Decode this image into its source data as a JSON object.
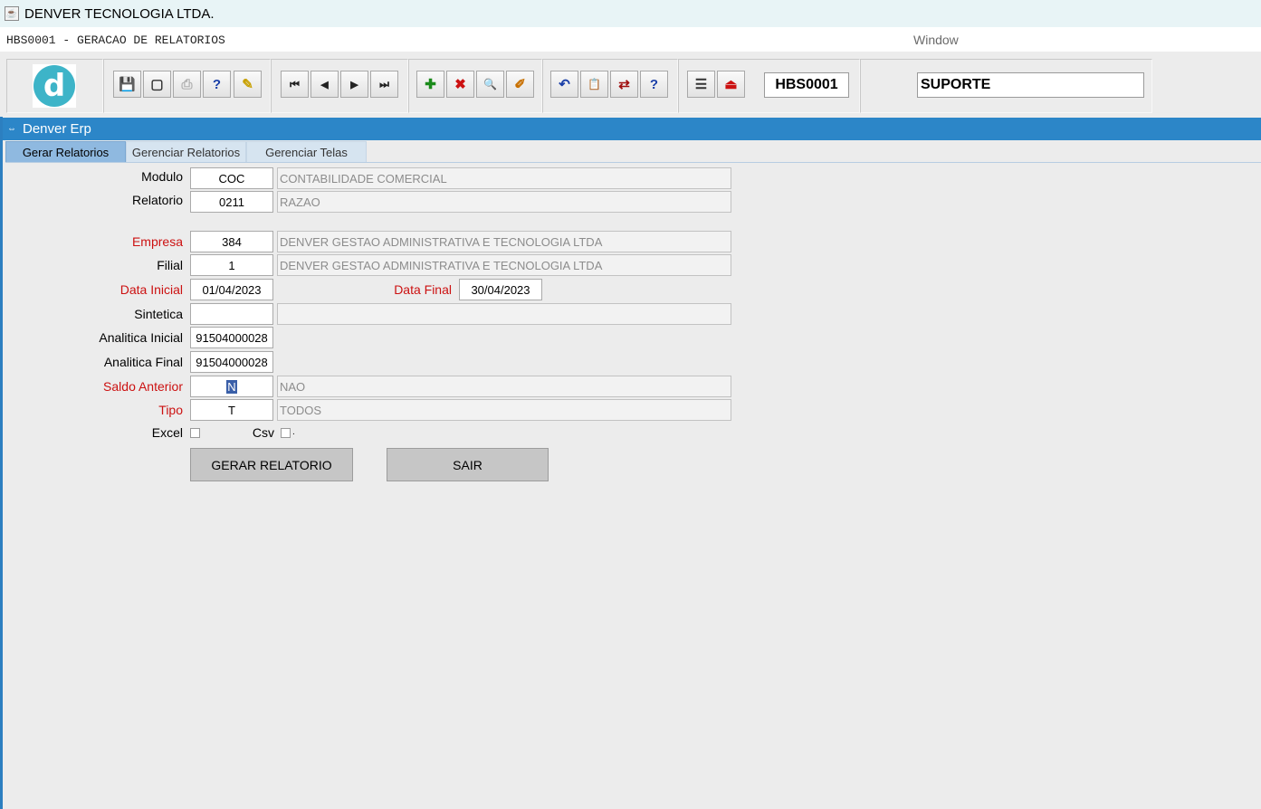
{
  "app": {
    "window_title": "DENVER TECNOLOGIA LTDA."
  },
  "menubar": {
    "form_title": "HBS0001 - GERACAO DE RELATORIOS",
    "window_menu": "Window"
  },
  "toolbar": {
    "logo_letter": "d",
    "form_code": "HBS0001",
    "user": "SUPORTE",
    "icons": {
      "save": "💾",
      "screen": "▢",
      "print": "⎙",
      "query": "?",
      "edit": "✎",
      "first": "⏮",
      "prev": "◀",
      "next": "▶",
      "last": "⏭",
      "add": "✚",
      "delete": "✖",
      "find": "🔍",
      "clear": "✐",
      "undo": "↶",
      "clipboard": "📋",
      "export": "⇄",
      "help": "?",
      "menu": "☰",
      "exit": "⏏"
    }
  },
  "panel": {
    "title": "Denver Erp"
  },
  "tabs": [
    {
      "label": "Gerar Relatorios"
    },
    {
      "label": "Gerenciar Relatorios"
    },
    {
      "label": "Gerenciar Telas"
    }
  ],
  "form": {
    "modulo": {
      "label": "Modulo",
      "value": "COC",
      "desc": "CONTABILIDADE COMERCIAL"
    },
    "relatorio": {
      "label": "Relatorio",
      "value": "0211",
      "desc": "RAZAO"
    },
    "empresa": {
      "label": "Empresa",
      "value": "384",
      "desc": "DENVER GESTAO ADMINISTRATIVA E TECNOLOGIA LTDA"
    },
    "filial": {
      "label": "Filial",
      "value": "1",
      "desc": "DENVER GESTAO ADMINISTRATIVA E TECNOLOGIA LTDA"
    },
    "data_inicial": {
      "label": "Data Inicial",
      "value": "01/04/2023"
    },
    "data_final": {
      "label": "Data Final",
      "value": "30/04/2023"
    },
    "sintetica": {
      "label": "Sintetica",
      "value": "",
      "desc": ""
    },
    "analitica_inicial": {
      "label": "Analitica Inicial",
      "value": "91504000028"
    },
    "analitica_final": {
      "label": "Analitica Final",
      "value": "91504000028"
    },
    "saldo_anterior": {
      "label": "Saldo Anterior",
      "value": "N",
      "desc": "NAO"
    },
    "tipo": {
      "label": "Tipo",
      "value": "T",
      "desc": "TODOS"
    },
    "excel": {
      "label": "Excel"
    },
    "csv": {
      "label": "Csv",
      "suffix": "."
    }
  },
  "buttons": {
    "gerar": "GERAR RELATORIO",
    "sair": "SAIR"
  },
  "colors": {
    "header_blue": "#2c86c8",
    "required_label": "#cc1111",
    "logo_teal": "#3db4c8"
  }
}
